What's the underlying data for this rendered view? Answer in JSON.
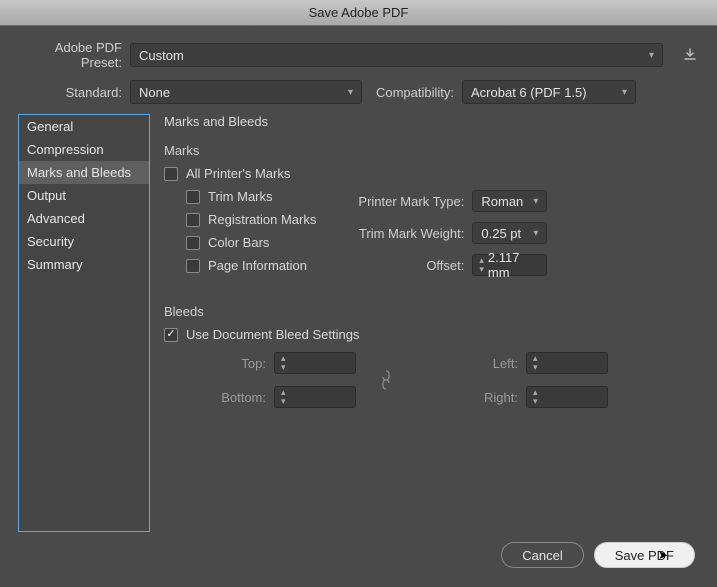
{
  "title": "Save Adobe PDF",
  "preset": {
    "label": "Adobe PDF Preset:",
    "value": "Custom"
  },
  "standard": {
    "label": "Standard:",
    "value": "None"
  },
  "compat": {
    "label": "Compatibility:",
    "value": "Acrobat 6 (PDF 1.5)"
  },
  "sidebar": {
    "items": [
      {
        "label": "General"
      },
      {
        "label": "Compression"
      },
      {
        "label": "Marks and Bleeds"
      },
      {
        "label": "Output"
      },
      {
        "label": "Advanced"
      },
      {
        "label": "Security"
      },
      {
        "label": "Summary"
      }
    ],
    "selected_index": 2
  },
  "panel": {
    "title": "Marks and Bleeds",
    "marks": {
      "section": "Marks",
      "all": {
        "label": "All Printer's Marks",
        "checked": false
      },
      "trim": {
        "label": "Trim Marks",
        "checked": false
      },
      "reg": {
        "label": "Registration Marks",
        "checked": false
      },
      "colorbars": {
        "label": "Color Bars",
        "checked": false
      },
      "pageinfo": {
        "label": "Page Information",
        "checked": false
      },
      "type": {
        "label": "Printer Mark Type:",
        "value": "Roman"
      },
      "weight": {
        "label": "Trim Mark Weight:",
        "value": "0.25 pt"
      },
      "offset": {
        "label": "Offset:",
        "value": "2.117 mm"
      }
    },
    "bleeds": {
      "section": "Bleeds",
      "usedoc": {
        "label": "Use Document Bleed Settings",
        "checked": true
      },
      "top": {
        "label": "Top:",
        "value": ""
      },
      "bottom": {
        "label": "Bottom:",
        "value": ""
      },
      "left": {
        "label": "Left:",
        "value": ""
      },
      "right": {
        "label": "Right:",
        "value": ""
      }
    }
  },
  "buttons": {
    "cancel": "Cancel",
    "save": "Save PDF"
  }
}
